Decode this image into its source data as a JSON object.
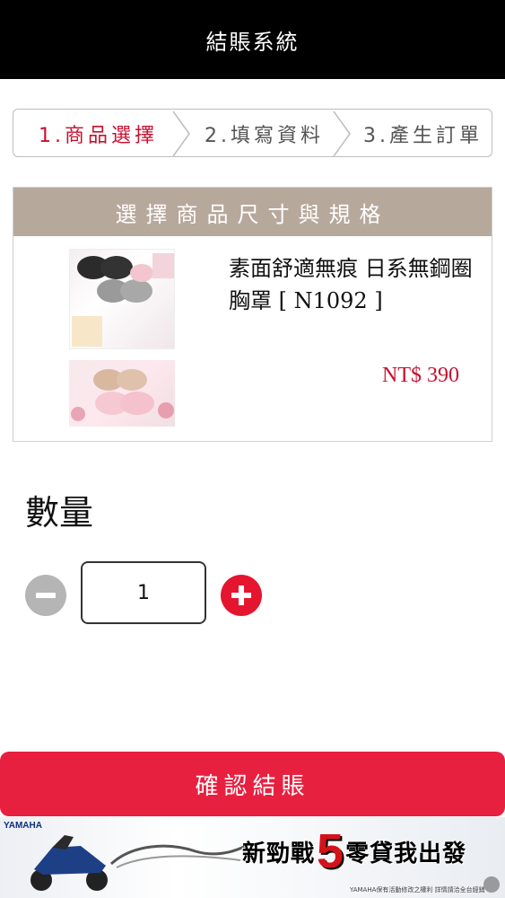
{
  "header": {
    "title": "結賬系統"
  },
  "steps": [
    {
      "label": "1.商品選擇",
      "active": true
    },
    {
      "label": "2.填寫資料",
      "active": false
    },
    {
      "label": "3.產生訂單",
      "active": false
    }
  ],
  "product": {
    "section_title": "選擇商品尺寸與規格",
    "name": "素面舒適無痕 日系無鋼圈胸罩 [ N1092 ]",
    "price": "NT$ 390"
  },
  "quantity": {
    "label": "數量",
    "value": "1"
  },
  "confirm_button": "確認結賬",
  "ad": {
    "brand": "YAMAHA",
    "slogan_a": "新勁戰",
    "slogan_num": "5",
    "slogan_b": "零貸我出發",
    "fine_print": "YAMAHA保有活動修改之權利 詳情請洽全台經銷"
  },
  "colors": {
    "accent_red": "#e8203f",
    "step_active": "#c8102e",
    "section_header": "#b7a89c",
    "topbar": "#000000"
  }
}
